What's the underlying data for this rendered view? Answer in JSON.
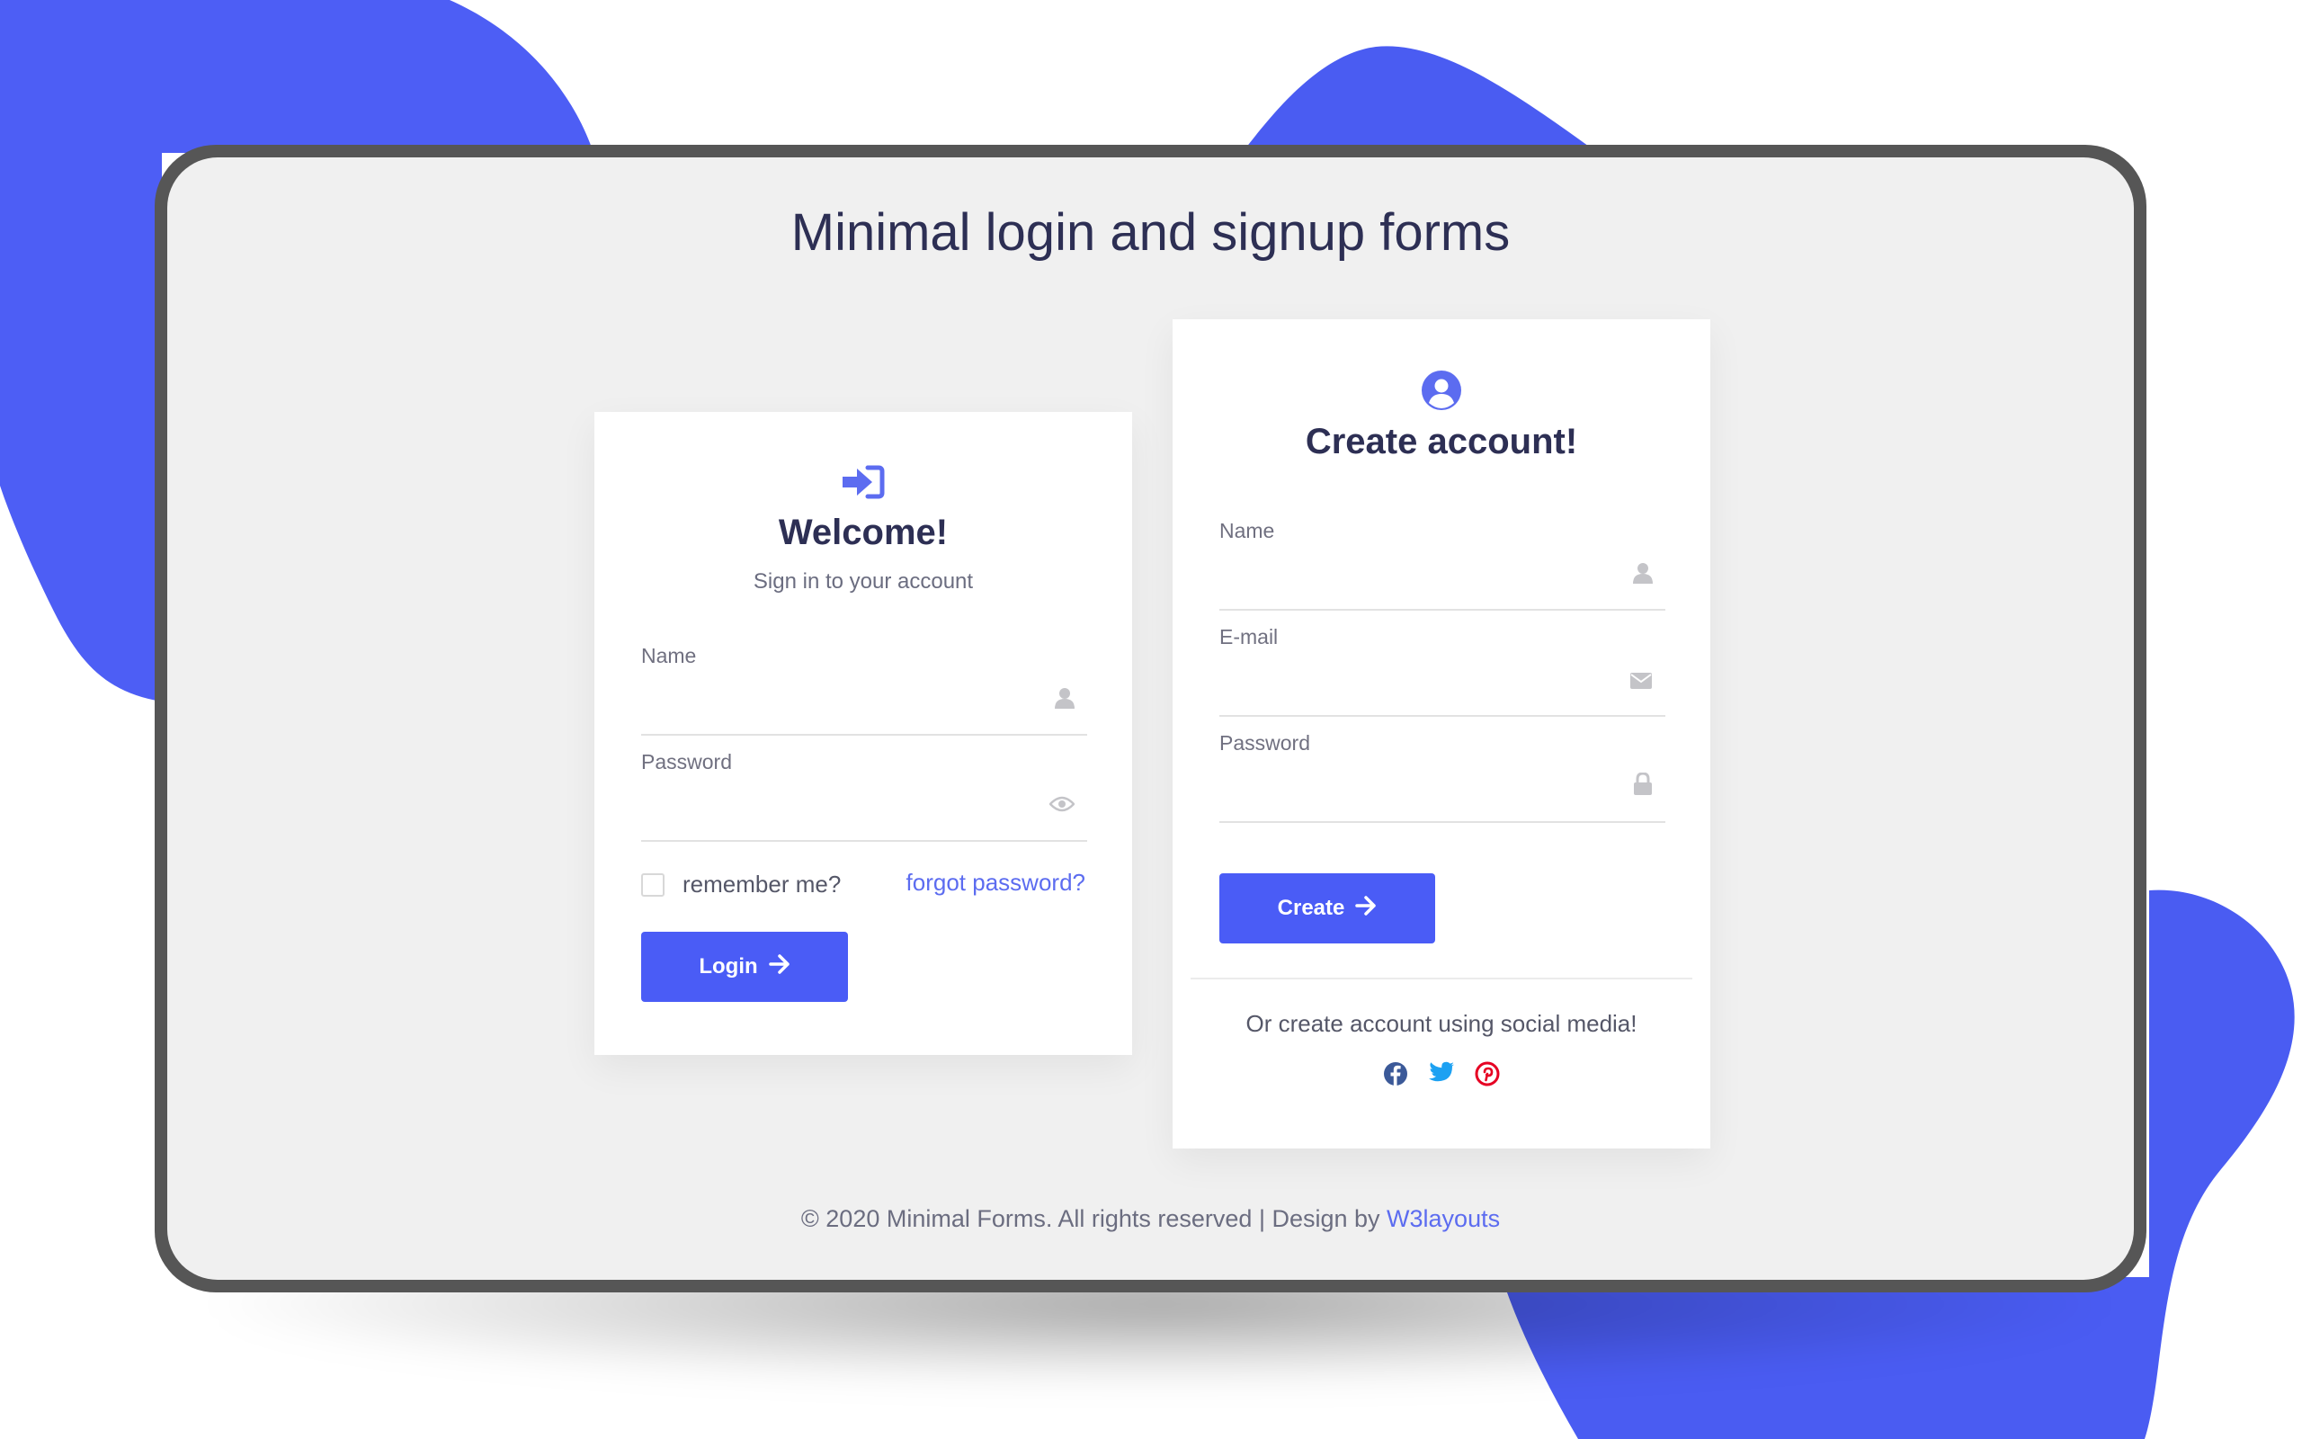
{
  "page": {
    "title": "Minimal login and signup forms",
    "accent_color": "#4a5cf6",
    "blob_color": "#4d5ef5"
  },
  "login": {
    "icon": "sign-in-icon",
    "title": "Welcome!",
    "subtitle": "Sign in to your account",
    "name_label": "Name",
    "name_value": "",
    "name_icon": "user-icon",
    "password_label": "Password",
    "password_value": "",
    "password_icon": "eye-icon",
    "remember_label": "remember me?",
    "remember_checked": false,
    "forgot_label": "forgot password?",
    "button_label": "Login",
    "button_icon": "arrow-right-icon"
  },
  "signup": {
    "icon": "user-circle-icon",
    "title": "Create account!",
    "name_label": "Name",
    "name_value": "",
    "name_icon": "user-icon",
    "email_label": "E-mail",
    "email_value": "",
    "email_icon": "envelope-icon",
    "password_label": "Password",
    "password_value": "",
    "password_icon": "lock-icon",
    "button_label": "Create",
    "button_icon": "arrow-right-icon",
    "social_text": "Or create account using social media!",
    "social": [
      {
        "name": "facebook-icon",
        "color": "#3b5998"
      },
      {
        "name": "twitter-icon",
        "color": "#1da1f2"
      },
      {
        "name": "pinterest-icon",
        "color": "#e60023"
      }
    ]
  },
  "footer": {
    "text": "© 2020 Minimal Forms. All rights reserved | Design by",
    "link": "W3layouts"
  }
}
